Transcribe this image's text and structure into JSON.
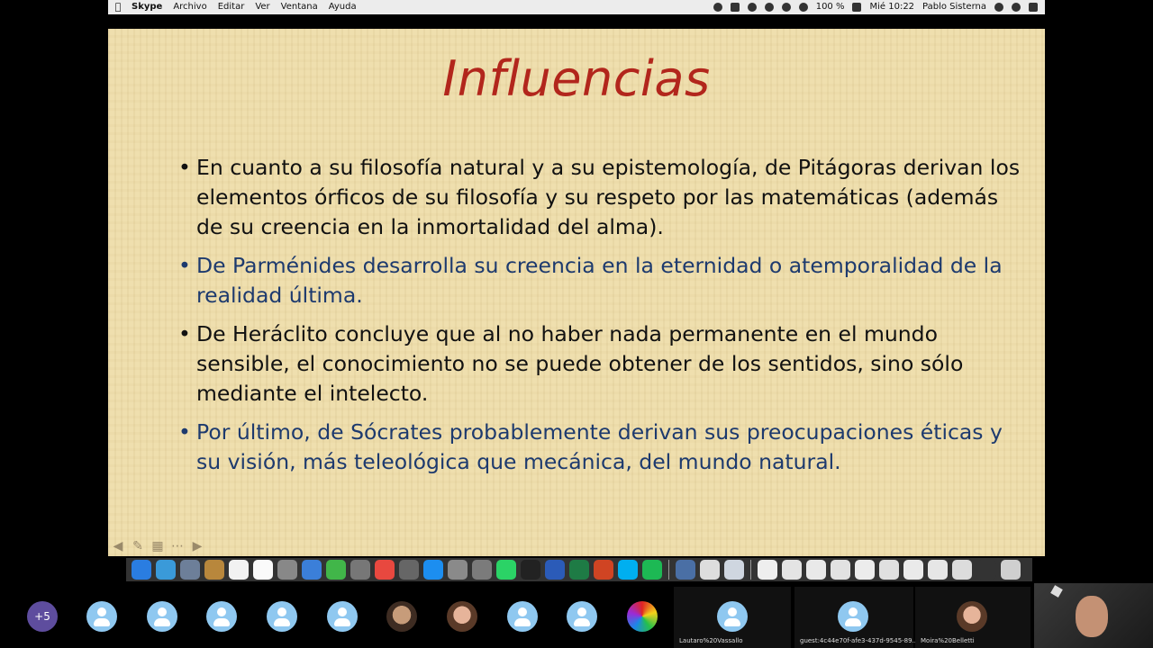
{
  "menubar": {
    "app_name": "Skype",
    "menus": [
      "Archivo",
      "Editar",
      "Ver",
      "Ventana",
      "Ayuda"
    ],
    "battery": "100 %",
    "clock": "Mié 10:22",
    "user": "Pablo Sisterna"
  },
  "slide": {
    "title": "Influencias",
    "bullets": [
      "En cuanto a su filosofía natural y a su epistemología, de Pitágoras derivan los elementos órficos de su filosofía y su respeto por las matemáticas (además de su creencia en la inmortalidad del alma).",
      "De Parménides desarrolla su creencia en la eternidad o atemporalidad de la realidad última.",
      "De Heráclito concluye que al no haber nada permanente en el mundo sensible, el conocimiento no se puede obtener de los sentidos, sino sólo mediante el intelecto.",
      "Por último, de Sócrates probablemente derivan sus preocupaciones éticas y su visión, más teleológica que mecánica, del mundo natural."
    ],
    "bullet_symbol": "•"
  },
  "participants": {
    "more_count": "+5",
    "names": [
      "Lautaro%20Vassallo",
      "guest:4c44e70f-afe3-437d-9545-89...",
      "Moira%20Belletti"
    ]
  },
  "colors": {
    "title": "#b2261c",
    "bullet_black": "#111111",
    "bullet_blue": "#1d3a6e",
    "slide_bg": "#efdfae"
  }
}
